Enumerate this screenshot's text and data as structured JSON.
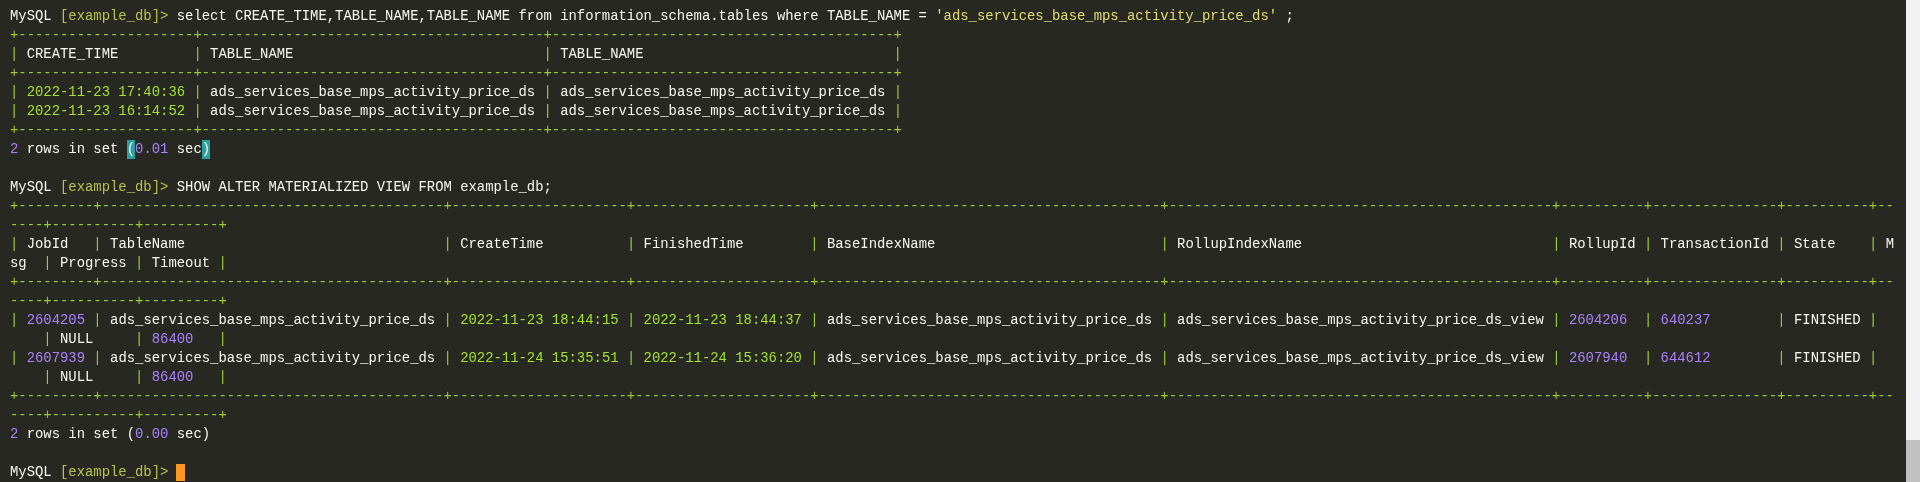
{
  "blocks": [
    {
      "lines": [
        [
          {
            "kind": "plain",
            "text": "MySQL "
          },
          {
            "kind": "prompt",
            "text": "[example_db]>"
          },
          {
            "kind": "plain",
            "text": " select CREATE_TIME,TABLE_NAME,TABLE_NAME from information_schema.tables where TABLE_NAME = "
          },
          {
            "kind": "string",
            "text": "'ads_services_base_mps_activity_price_ds'"
          },
          {
            "kind": "plain",
            "text": " ;"
          }
        ],
        [
          {
            "kind": "border",
            "text": "+---------------------+-----------------------------------------+-----------------------------------------+"
          }
        ],
        [
          {
            "kind": "border",
            "text": "| "
          },
          {
            "kind": "header",
            "text": "CREATE_TIME"
          },
          {
            "kind": "border",
            "text": "         | "
          },
          {
            "kind": "header",
            "text": "TABLE_NAME"
          },
          {
            "kind": "border",
            "text": "                              | "
          },
          {
            "kind": "header",
            "text": "TABLE_NAME"
          },
          {
            "kind": "border",
            "text": "                              |"
          }
        ],
        [
          {
            "kind": "border",
            "text": "+---------------------+-----------------------------------------+-----------------------------------------+"
          }
        ],
        [
          {
            "kind": "border",
            "text": "| "
          },
          {
            "kind": "date",
            "text": "2022-11-23 17:40:36"
          },
          {
            "kind": "border",
            "text": " | "
          },
          {
            "kind": "cell",
            "text": "ads_services_base_mps_activity_price_ds"
          },
          {
            "kind": "border",
            "text": " | "
          },
          {
            "kind": "cell",
            "text": "ads_services_base_mps_activity_price_ds"
          },
          {
            "kind": "border",
            "text": " |"
          }
        ],
        [
          {
            "kind": "border",
            "text": "| "
          },
          {
            "kind": "date",
            "text": "2022-11-23 16:14:52"
          },
          {
            "kind": "border",
            "text": " | "
          },
          {
            "kind": "cell",
            "text": "ads_services_base_mps_activity_price_ds"
          },
          {
            "kind": "border",
            "text": " | "
          },
          {
            "kind": "cell",
            "text": "ads_services_base_mps_activity_price_ds"
          },
          {
            "kind": "border",
            "text": " |"
          }
        ],
        [
          {
            "kind": "border",
            "text": "+---------------------+-----------------------------------------+-----------------------------------------+"
          }
        ],
        [
          {
            "kind": "number",
            "text": "2"
          },
          {
            "kind": "plain",
            "text": " rows in set "
          },
          {
            "kind": "bracket",
            "text": "("
          },
          {
            "kind": "number",
            "text": "0.01"
          },
          {
            "kind": "plain",
            "text": " sec"
          },
          {
            "kind": "bracket",
            "text": ")"
          }
        ]
      ]
    },
    {
      "lines": [
        [
          {
            "kind": "plain",
            "text": "MySQL "
          },
          {
            "kind": "prompt",
            "text": "[example_db]>"
          },
          {
            "kind": "plain",
            "text": " SHOW ALTER MATERIALIZED VIEW FROM example_db;"
          }
        ],
        [
          {
            "kind": "border",
            "text": "+---------+-----------------------------------------+---------------------+---------------------+-----------------------------------------+----------------------------------------------+----------+---------------+----------+--"
          }
        ],
        [
          {
            "kind": "border",
            "text": "----+----------+---------+"
          }
        ],
        [
          {
            "kind": "border",
            "text": "| "
          },
          {
            "kind": "header",
            "text": "JobId"
          },
          {
            "kind": "border",
            "text": "   | "
          },
          {
            "kind": "header",
            "text": "TableName"
          },
          {
            "kind": "border",
            "text": "                               | "
          },
          {
            "kind": "header",
            "text": "CreateTime"
          },
          {
            "kind": "border",
            "text": "          | "
          },
          {
            "kind": "header",
            "text": "FinishedTime"
          },
          {
            "kind": "border",
            "text": "        | "
          },
          {
            "kind": "header",
            "text": "BaseIndexName"
          },
          {
            "kind": "border",
            "text": "                           | "
          },
          {
            "kind": "header",
            "text": "RollupIndexName"
          },
          {
            "kind": "border",
            "text": "                              | "
          },
          {
            "kind": "header",
            "text": "RollupId"
          },
          {
            "kind": "border",
            "text": " | "
          },
          {
            "kind": "header",
            "text": "TransactionId"
          },
          {
            "kind": "border",
            "text": " | "
          },
          {
            "kind": "header",
            "text": "State"
          },
          {
            "kind": "border",
            "text": "    | "
          },
          {
            "kind": "header",
            "text": "M"
          }
        ],
        [
          {
            "kind": "header",
            "text": "sg"
          },
          {
            "kind": "border",
            "text": "  | "
          },
          {
            "kind": "header",
            "text": "Progress"
          },
          {
            "kind": "border",
            "text": " | "
          },
          {
            "kind": "header",
            "text": "Timeout"
          },
          {
            "kind": "border",
            "text": " |"
          }
        ],
        [
          {
            "kind": "border",
            "text": "+---------+-----------------------------------------+---------------------+---------------------+-----------------------------------------+----------------------------------------------+----------+---------------+----------+--"
          }
        ],
        [
          {
            "kind": "border",
            "text": "----+----------+---------+"
          }
        ],
        [
          {
            "kind": "border",
            "text": "| "
          },
          {
            "kind": "number",
            "text": "2604205"
          },
          {
            "kind": "border",
            "text": " | "
          },
          {
            "kind": "cell",
            "text": "ads_services_base_mps_activity_price_ds"
          },
          {
            "kind": "border",
            "text": " | "
          },
          {
            "kind": "date",
            "text": "2022-11-23 18:44:15"
          },
          {
            "kind": "border",
            "text": " | "
          },
          {
            "kind": "date",
            "text": "2022-11-23 18:44:37"
          },
          {
            "kind": "border",
            "text": " | "
          },
          {
            "kind": "cell",
            "text": "ads_services_base_mps_activity_price_ds"
          },
          {
            "kind": "border",
            "text": " | "
          },
          {
            "kind": "cell",
            "text": "ads_services_base_mps_activity_price_ds_view"
          },
          {
            "kind": "border",
            "text": " | "
          },
          {
            "kind": "number",
            "text": "2604206"
          },
          {
            "kind": "border",
            "text": "  | "
          },
          {
            "kind": "number",
            "text": "640237"
          },
          {
            "kind": "border",
            "text": "        | "
          },
          {
            "kind": "cell",
            "text": "FINISHED"
          },
          {
            "kind": "border",
            "text": " |"
          }
        ],
        [
          {
            "kind": "border",
            "text": "    | "
          },
          {
            "kind": "cell",
            "text": "NULL"
          },
          {
            "kind": "border",
            "text": "     | "
          },
          {
            "kind": "number",
            "text": "86400"
          },
          {
            "kind": "border",
            "text": "   |"
          }
        ],
        [
          {
            "kind": "border",
            "text": "| "
          },
          {
            "kind": "number",
            "text": "2607939"
          },
          {
            "kind": "border",
            "text": " | "
          },
          {
            "kind": "cell",
            "text": "ads_services_base_mps_activity_price_ds"
          },
          {
            "kind": "border",
            "text": " | "
          },
          {
            "kind": "date",
            "text": "2022-11-24 15:35:51"
          },
          {
            "kind": "border",
            "text": " | "
          },
          {
            "kind": "date",
            "text": "2022-11-24 15:36:20"
          },
          {
            "kind": "border",
            "text": " | "
          },
          {
            "kind": "cell",
            "text": "ads_services_base_mps_activity_price_ds"
          },
          {
            "kind": "border",
            "text": " | "
          },
          {
            "kind": "cell",
            "text": "ads_services_base_mps_activity_price_ds_view"
          },
          {
            "kind": "border",
            "text": " | "
          },
          {
            "kind": "number",
            "text": "2607940"
          },
          {
            "kind": "border",
            "text": "  | "
          },
          {
            "kind": "number",
            "text": "644612"
          },
          {
            "kind": "border",
            "text": "        | "
          },
          {
            "kind": "cell",
            "text": "FINISHED"
          },
          {
            "kind": "border",
            "text": " |"
          }
        ],
        [
          {
            "kind": "border",
            "text": "    | "
          },
          {
            "kind": "cell",
            "text": "NULL"
          },
          {
            "kind": "border",
            "text": "     | "
          },
          {
            "kind": "number",
            "text": "86400"
          },
          {
            "kind": "border",
            "text": "   |"
          }
        ],
        [
          {
            "kind": "border",
            "text": "+---------+-----------------------------------------+---------------------+---------------------+-----------------------------------------+----------------------------------------------+----------+---------------+----------+--"
          }
        ],
        [
          {
            "kind": "border",
            "text": "----+----------+---------+"
          }
        ],
        [
          {
            "kind": "number",
            "text": "2"
          },
          {
            "kind": "plain",
            "text": " rows in set ("
          },
          {
            "kind": "number",
            "text": "0.00"
          },
          {
            "kind": "plain",
            "text": " sec)"
          }
        ]
      ]
    },
    {
      "lines": [
        [
          {
            "kind": "plain",
            "text": "MySQL "
          },
          {
            "kind": "prompt",
            "text": "[example_db]>"
          }
        ]
      ]
    }
  ],
  "cursor_visible": true
}
